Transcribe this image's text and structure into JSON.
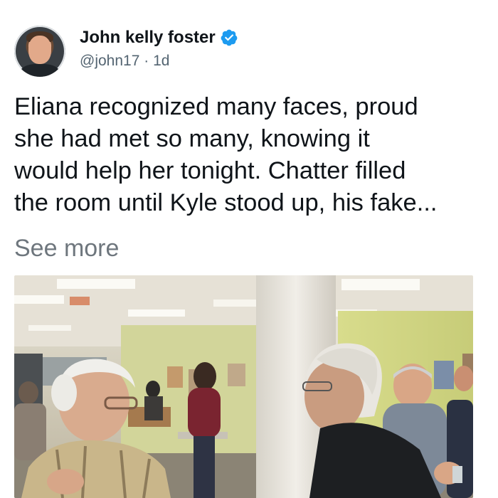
{
  "tweet": {
    "author": {
      "display_name": "John kelly foster",
      "handle": "@john17",
      "separator": " · ",
      "time_ago": "1d",
      "verified_icon": "verified-badge-icon",
      "verified_color": "#1d9bf0"
    },
    "text_lines": [
      "Eliana recognized many faces, proud",
      "she had met so many, knowing it",
      "would help her tonight. Chatter filled",
      "the room until Kyle stood up, his fake..."
    ],
    "see_more_label": "See more",
    "colors": {
      "text": "#0f1419",
      "secondary": "#536471",
      "see_more": "#6e767d"
    }
  }
}
